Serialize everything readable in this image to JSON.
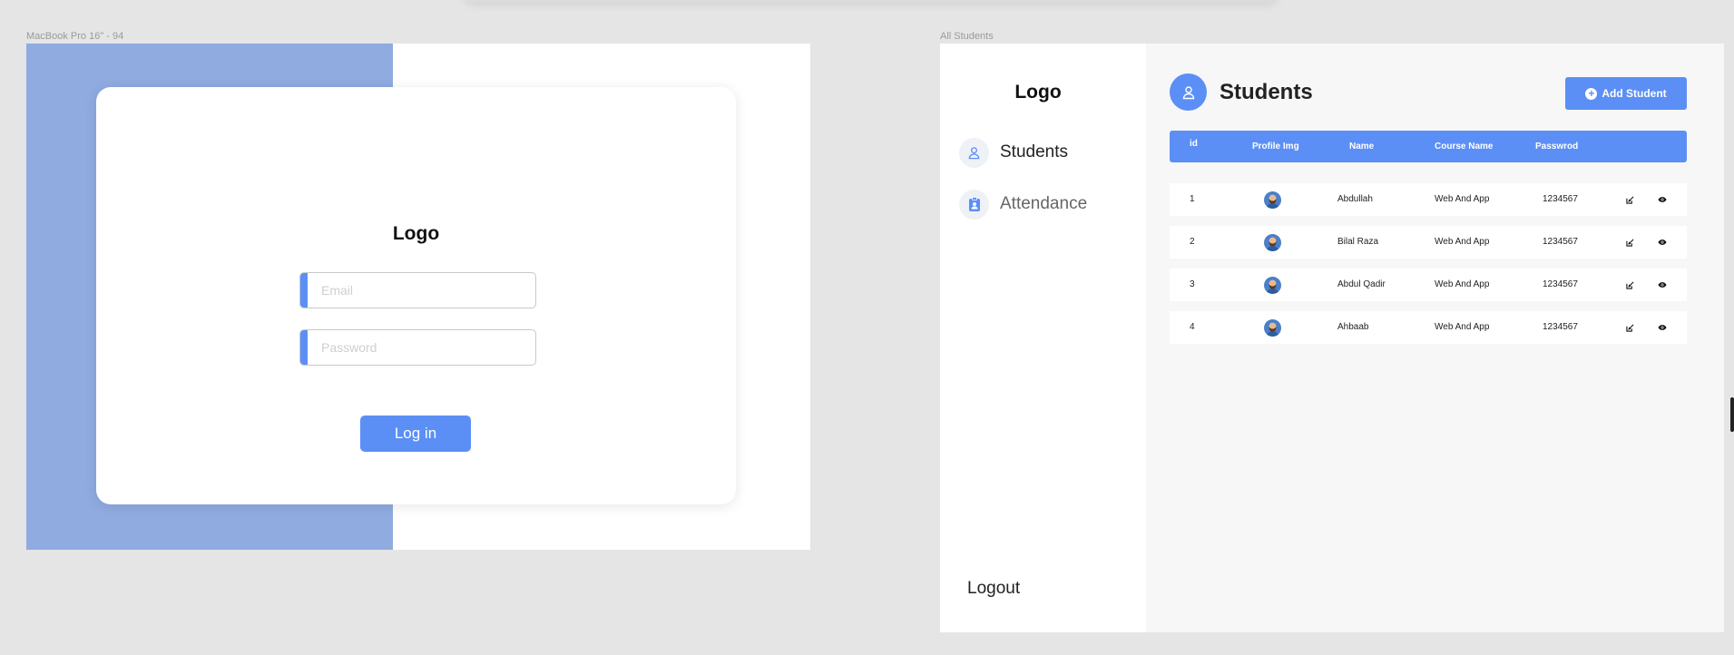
{
  "canvas": {
    "left_frame_label": "MacBook Pro 16\" - 94",
    "right_frame_label": "All Students"
  },
  "login": {
    "logo": "Logo",
    "email_placeholder": "Email",
    "password_placeholder": "Password",
    "login_button": "Log in"
  },
  "sidebar": {
    "logo": "Logo",
    "items": [
      {
        "label": "Students",
        "icon": "user-icon"
      },
      {
        "label": "Attendance",
        "icon": "clipboard-user-icon"
      }
    ],
    "logout": "Logout"
  },
  "main": {
    "title": "Students",
    "add_button": "Add Student",
    "columns": [
      "id",
      "Profile Img",
      "Name",
      "Course Name",
      "Passwrod"
    ],
    "rows": [
      {
        "id": "1",
        "name": "Abdullah",
        "course": "Web And App",
        "password": "1234567"
      },
      {
        "id": "2",
        "name": "Bilal Raza",
        "course": "Web And App",
        "password": "1234567"
      },
      {
        "id": "3",
        "name": "Abdul Qadir",
        "course": "Web And App",
        "password": "1234567"
      },
      {
        "id": "4",
        "name": "Ahbaab",
        "course": "Web And App",
        "password": "1234567"
      }
    ]
  },
  "colors": {
    "accent": "#5b8ff5",
    "login_panel": "#8fabe0",
    "background": "#e5e5e5"
  }
}
